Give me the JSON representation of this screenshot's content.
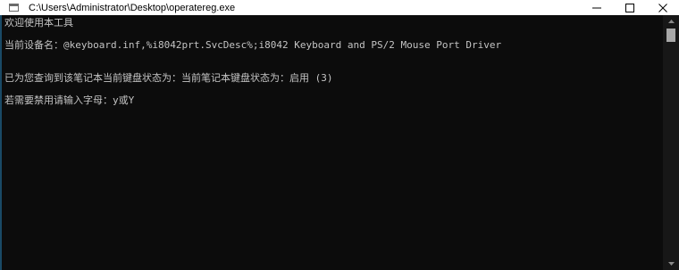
{
  "window": {
    "title": "C:\\Users\\Administrator\\Desktop\\operatereg.exe",
    "app_icon": "console-app-icon",
    "controls": {
      "minimize_icon": "minimize-icon",
      "maximize_icon": "maximize-icon",
      "close_icon": "close-icon"
    }
  },
  "console": {
    "lines": [
      "欢迎使用本工具",
      "当前设备名：@keyboard.inf,%i8042prt.SvcDesc%;i8042 Keyboard and PS/2 Mouse Port Driver",
      "已为您查询到该笔记本当前键盘状态为：当前笔记本键盘状态为：启用 (3)",
      "若需要禁用请输入字母：y或Y"
    ]
  },
  "scrollbar": {
    "up_icon": "scroll-up-arrow-icon",
    "down_icon": "scroll-down-arrow-icon"
  },
  "colors": {
    "console_bg": "#0c0c0c",
    "console_text": "#c4c4c4",
    "titlebar_bg": "#ffffff",
    "scrollbar_bg": "#171717",
    "scroll_thumb": "#a8a8a8"
  }
}
